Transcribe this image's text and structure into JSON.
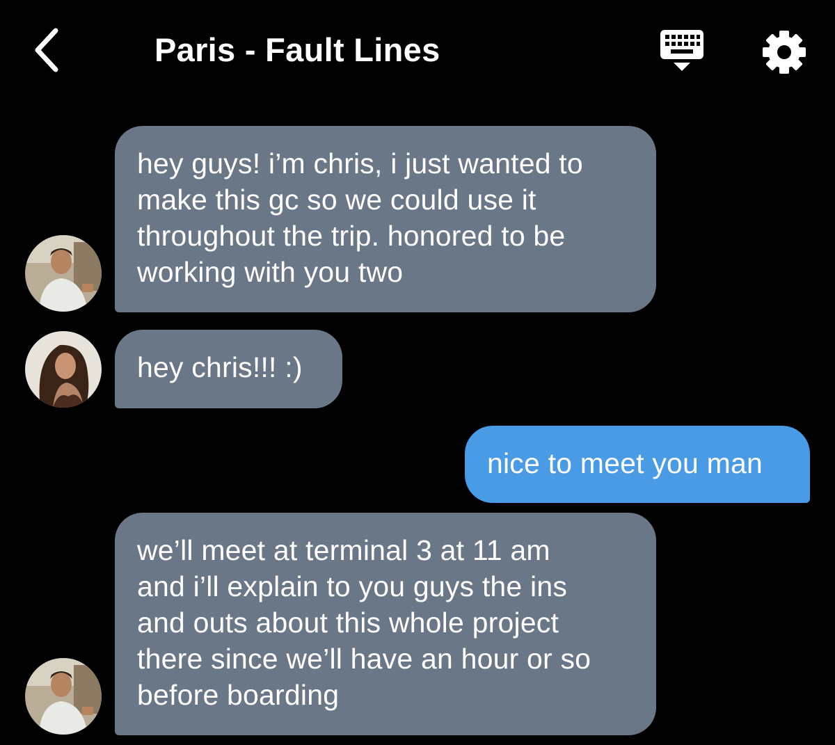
{
  "header": {
    "title": "Paris - Fault Lines",
    "back_icon": "chevron-left-icon",
    "keyboard_icon": "keyboard-icon",
    "settings_icon": "gear-icon"
  },
  "colors": {
    "background": "#000000",
    "incoming_bubble": "#6a7786",
    "outgoing_bubble": "#4a9be6",
    "text": "#ffffff"
  },
  "messages": [
    {
      "direction": "incoming",
      "sender_avatar": "chris-avatar",
      "text": "hey guys! i’m chris, i just wanted to\nmake this gc so we could use it\nthroughout the trip. honored to be\nworking with you two"
    },
    {
      "direction": "incoming",
      "sender_avatar": "woman-avatar",
      "text": "hey chris!!! :)"
    },
    {
      "direction": "outgoing",
      "text": "nice to meet you man"
    },
    {
      "direction": "incoming",
      "sender_avatar": "chris-avatar",
      "text": "we’ll meet at terminal 3 at 11 am\nand i’ll explain to you guys the ins\nand outs about this whole project\nthere since we’ll have an hour or so\nbefore boarding"
    }
  ]
}
